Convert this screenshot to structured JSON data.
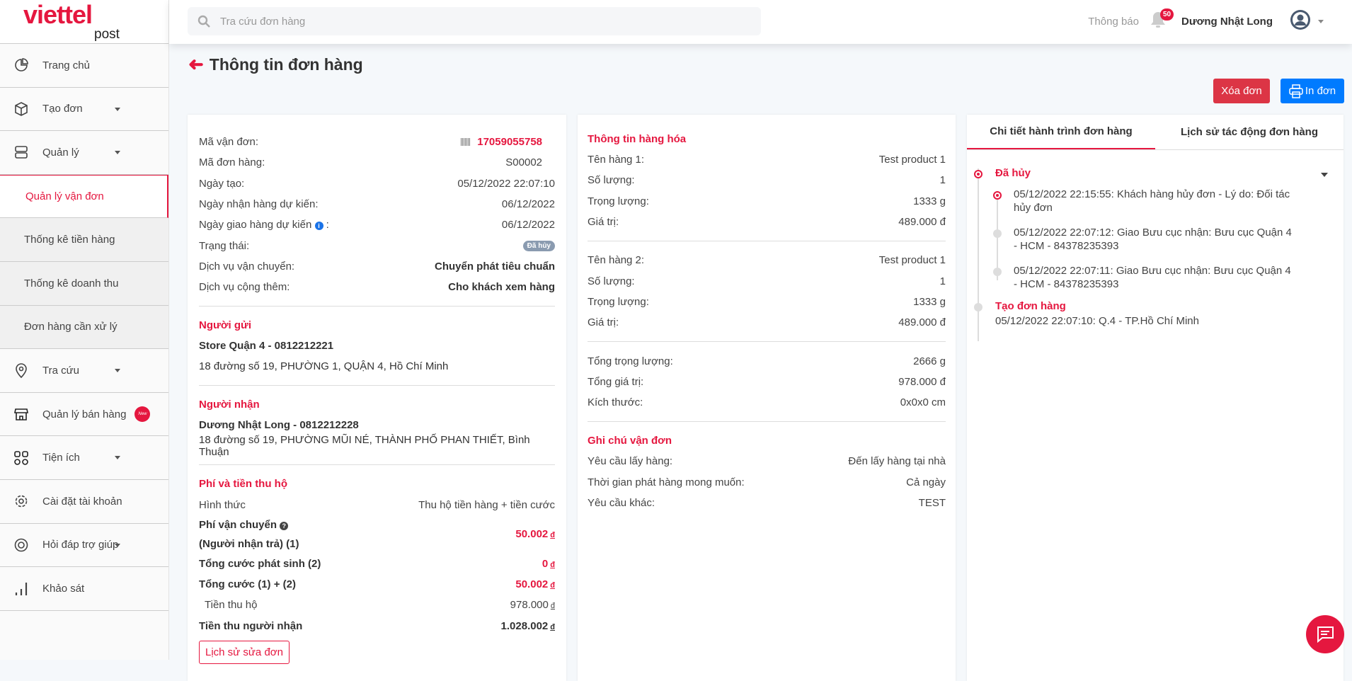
{
  "brand": {
    "word": "viettel",
    "sub": "post"
  },
  "header": {
    "search_placeholder": "Tra cứu đơn hàng",
    "notif_label": "Thông báo",
    "notif_count": "50",
    "user_name": "Dương Nhật Long"
  },
  "sidebar": {
    "items": [
      {
        "label": "Trang chủ",
        "icon": "pie-chart-icon"
      },
      {
        "label": "Tạo đơn",
        "icon": "box-icon"
      },
      {
        "label": "Quản lý",
        "icon": "server-icon"
      },
      {
        "label": "Quản lý vận đơn"
      },
      {
        "label": "Thống kê tiền hàng"
      },
      {
        "label": "Thống kê doanh thu"
      },
      {
        "label": "Đơn hàng cần xử lý"
      },
      {
        "label": "Tra cứu",
        "icon": "map-pin-icon"
      },
      {
        "label": "Quản lý bán hàng",
        "icon": "store-icon",
        "badge": "New"
      },
      {
        "label": "Tiện ích",
        "icon": "grid-icon"
      },
      {
        "label": "Cài đặt tài khoản",
        "icon": "gear-icon"
      },
      {
        "label": "Hỏi đáp trợ giúp",
        "icon": "lifebuoy-icon"
      },
      {
        "label": "Khảo sát",
        "icon": "bar-chart-icon"
      }
    ]
  },
  "page": {
    "title": "Thông tin đơn hàng",
    "delete_label": "Xóa đơn",
    "print_label": "In đơn"
  },
  "order": {
    "rows": [
      {
        "label": "Mã vận đơn:",
        "value": "17059055758"
      },
      {
        "label": "Mã đơn hàng:",
        "value": "S00002"
      },
      {
        "label": "Ngày tạo:",
        "value": "05/12/2022 22:07:10"
      },
      {
        "label": "Ngày nhận hàng dự kiến:",
        "value": "06/12/2022"
      },
      {
        "label": "Ngày giao hàng dự kiến",
        "suffix": ":",
        "value": "06/12/2022"
      },
      {
        "label": "Trạng thái:",
        "value": "Đã hủy"
      },
      {
        "label": "Dịch vụ vận chuyển:",
        "value": "Chuyển phát tiêu chuẩn"
      },
      {
        "label": "Dịch vụ cộng thêm:",
        "value": "Cho khách xem hàng"
      }
    ],
    "sender": {
      "title": "Người gửi",
      "name": "Store Quận 4 - 0812212221",
      "address": "18 đường số 19, PHƯỜNG 1, QUẬN 4, Hồ Chí Minh"
    },
    "receiver": {
      "title": "Người nhận",
      "name": "Dương Nhật Long - 0812212228",
      "address": "18 đường số 19, PHƯỜNG MŨI NÉ, THÀNH PHỐ PHAN THIẾT, Bình Thuận"
    },
    "fees": {
      "title": "Phí và tiền thu hộ",
      "method_label": "Hình thức",
      "method": "Thu hộ tiền hàng + tiền cước",
      "ship_label1": "Phí vận chuyển",
      "ship_label2": "(Người nhận trả) (1)",
      "ship": "50.002",
      "extra_label": "Tổng cước phát sinh (2)",
      "extra": "0",
      "total_label": "Tổng cước (1) + (2)",
      "total": "50.002",
      "cod_label": "Tiền thu hộ",
      "cod": "978.000",
      "receive_label": "Tiền thu người nhận",
      "receive": "1.028.002",
      "currency": "đ",
      "history_label": "Lịch sử sửa đơn"
    }
  },
  "goods": {
    "title": "Thông tin hàng hóa",
    "items": [
      {
        "name_label": "Tên hàng 1:",
        "name": "Test product 1",
        "qty_label": "Số lượng:",
        "qty": "1",
        "weight_label": "Trọng lượng:",
        "weight": "1333 g",
        "value_label": "Giá trị:",
        "value": "489.000 đ"
      },
      {
        "name_label": "Tên hàng 2:",
        "name": "Test product 1",
        "qty_label": "Số lượng:",
        "qty": "1",
        "weight_label": "Trọng lượng:",
        "weight": "1333 g",
        "value_label": "Giá trị:",
        "value": "489.000 đ"
      }
    ],
    "totals": [
      {
        "label": "Tổng trọng lượng:",
        "value": "2666 g"
      },
      {
        "label": "Tổng giá trị:",
        "value": "978.000 đ"
      },
      {
        "label": "Kích thước:",
        "value": "0x0x0 cm"
      }
    ],
    "notes_title": "Ghi chú vận đơn",
    "notes": [
      {
        "label": "Yêu cầu lấy hàng:",
        "value": "Đến lấy hàng tại nhà"
      },
      {
        "label": "Thời gian phát hàng mong muốn:",
        "value": "Cả ngày"
      },
      {
        "label": "Yêu cầu khác:",
        "value": "TEST"
      }
    ]
  },
  "journey": {
    "tabs": [
      "Chi tiết hành trình đơn hàng",
      "Lịch sử tác động đơn hàng"
    ],
    "status": "Đã hủy",
    "events": [
      "05/12/2022 22:15:55: Khách hàng hủy đơn - Lý do: Đối tác hủy đơn",
      "05/12/2022 22:07:12: Giao Bưu cục nhận: Bưu cục Quận 4 - HCM - 84378235393",
      "05/12/2022 22:07:11: Giao Bưu cục nhận: Bưu cục Quận 4 - HCM - 84378235393"
    ],
    "created_title": "Tạo đơn hàng",
    "created_detail": "05/12/2022 22:07:10: Q.4 - TP.Hồ Chí Minh"
  },
  "colors": {
    "brand": "#e5173f",
    "danger": "#dc3545",
    "primary": "#007bff"
  }
}
